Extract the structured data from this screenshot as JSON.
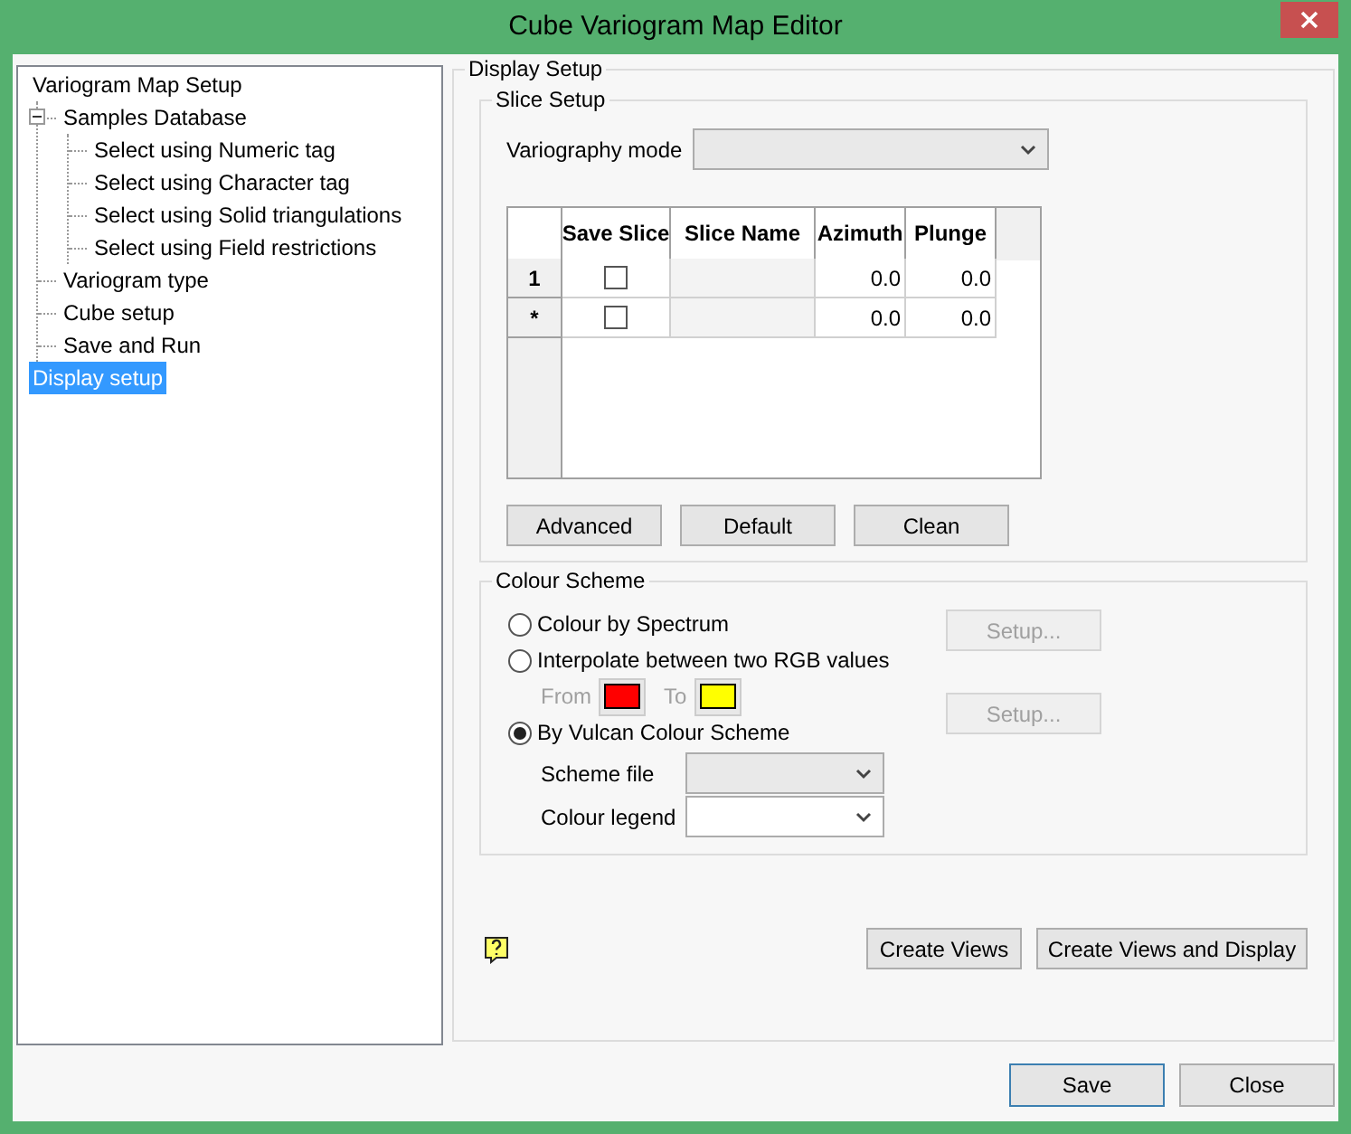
{
  "window": {
    "title": "Cube Variogram Map Editor"
  },
  "tree": [
    {
      "label": "Variogram Map Setup",
      "selected": false,
      "children": [
        {
          "label": "Samples Database",
          "selected": false,
          "expanded": true,
          "children": [
            {
              "label": "Select using Numeric tag",
              "selected": false
            },
            {
              "label": "Select using Character tag",
              "selected": false
            },
            {
              "label": "Select using Solid triangulations",
              "selected": false
            },
            {
              "label": "Select using Field restrictions",
              "selected": false
            }
          ]
        },
        {
          "label": "Variogram type",
          "selected": false
        },
        {
          "label": "Cube setup",
          "selected": false
        },
        {
          "label": "Save and Run",
          "selected": false
        }
      ]
    },
    {
      "label": "Display setup",
      "selected": true
    }
  ],
  "display_setup": {
    "title": "Display Setup",
    "slice_setup": {
      "title": "Slice Setup",
      "variography_mode_label": "Variography mode",
      "table": {
        "columns": [
          "Save Slice",
          "Slice Name",
          "Azimuth",
          "Plunge"
        ],
        "rows": [
          {
            "header": "1",
            "save_slice": false,
            "azimuth": "0.0",
            "plunge": "0.0"
          },
          {
            "header": "*",
            "save_slice": false,
            "azimuth": "0.0",
            "plunge": "0.0"
          }
        ]
      },
      "buttons": [
        "Advanced",
        "Default",
        "Clean"
      ]
    },
    "colour_scheme": {
      "title": "Colour Scheme",
      "options": [
        {
          "label": "Colour by Spectrum",
          "selected": false
        },
        {
          "label": "Interpolate between two RGB values",
          "selected": false
        },
        {
          "label": "By Vulcan Colour Scheme",
          "selected": true
        }
      ],
      "setup_buttons": [
        {
          "label": "Setup...",
          "disabled": true
        },
        {
          "label": "Setup...",
          "disabled": true
        }
      ],
      "from": {
        "label": "From",
        "color": "#ff0000",
        "disabled": true
      },
      "to": {
        "label": "To",
        "color": "#ffff00",
        "disabled": true
      },
      "scheme_file_label": "Scheme file",
      "colour_legend_label": "Colour legend"
    },
    "action_buttons": [
      "Create Views",
      "Create Views and Display"
    ]
  },
  "footer_buttons": [
    {
      "label": "Save",
      "default": true
    },
    {
      "label": "Close",
      "default": false
    }
  ]
}
